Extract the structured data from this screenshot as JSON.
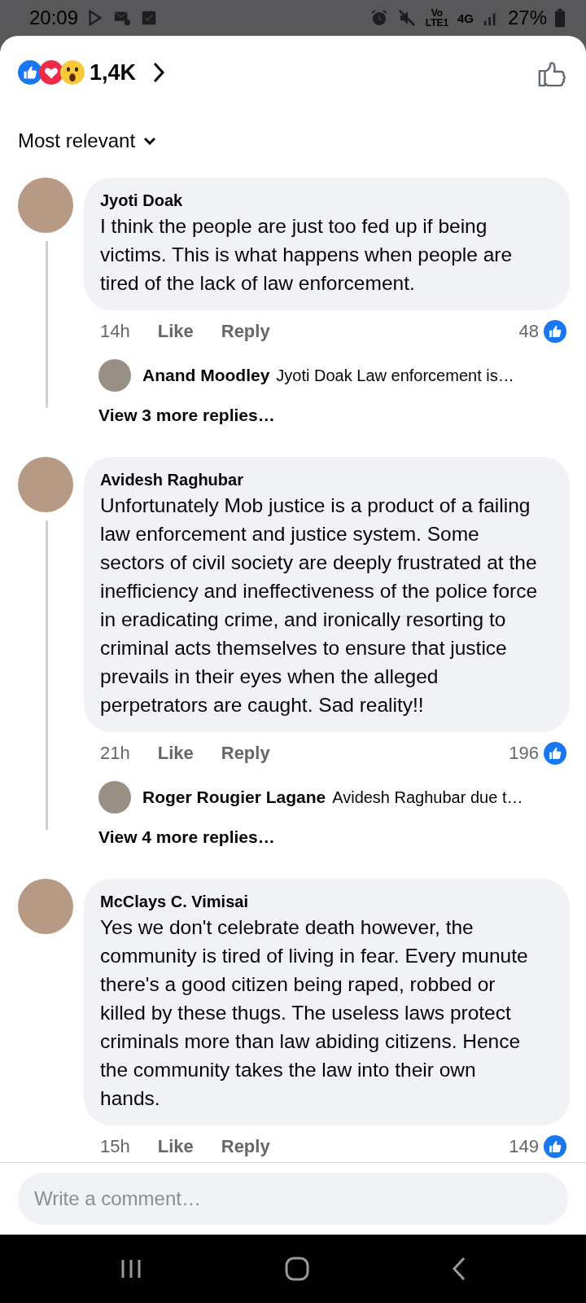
{
  "status_bar": {
    "time": "20:09",
    "volte": "Vo LTE1",
    "network": "4G",
    "battery": "27%"
  },
  "reactions": {
    "count": "1,4K"
  },
  "sort": {
    "label": "Most relevant"
  },
  "comments": [
    {
      "author": "Jyoti Doak",
      "text": "I think the people are just too fed up if being victims. This is what happens when people are tired of the lack of law enforcement.",
      "time": "14h",
      "like_label": "Like",
      "reply_label": "Reply",
      "likes": "48",
      "replies": [
        {
          "author": "Anand Moodley",
          "text": "Jyoti Doak Law enforcement is…"
        }
      ],
      "more_replies": "View 3 more replies…"
    },
    {
      "author": "Avidesh Raghubar",
      "text": "Unfortunately Mob justice is a product of a failing law enforcement and justice system. Some sectors of civil society are deeply frustrated at the inefficiency and ineffectiveness of the police force in eradicating crime, and ironically resorting to criminal acts themselves to ensure that justice prevails in their eyes when the alleged perpetrators are caught. Sad reality!!",
      "time": "21h",
      "like_label": "Like",
      "reply_label": "Reply",
      "likes": "196",
      "replies": [
        {
          "author": "Roger Rougier Lagane",
          "text": "Avidesh Raghubar due t…"
        }
      ],
      "more_replies": "View 4 more replies…"
    },
    {
      "author": "McClays C. Vimisai",
      "text": "Yes we don't celebrate death however, the community is tired of living in fear. Every munute there's a good citizen being raped, robbed or killed by these thugs. The useless laws protect criminals more than law abiding citizens. Hence the community takes the law into their own hands.",
      "time": "15h",
      "like_label": "Like",
      "reply_label": "Reply",
      "likes": "149"
    }
  ],
  "composer": {
    "placeholder": "Write a comment…"
  }
}
